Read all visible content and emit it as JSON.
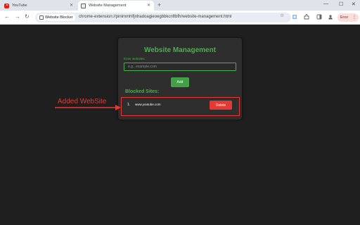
{
  "browser": {
    "tabs": [
      {
        "title": "YouTube",
        "icon": "youtube-icon",
        "active": false
      },
      {
        "title": "Website Management",
        "icon": "extension-page-icon",
        "active": true
      }
    ],
    "new_tab_symbol": "+",
    "window_controls": {
      "minimize": "—",
      "maximize": "☐",
      "close": "✕"
    },
    "nav": {
      "back": "←",
      "forward": "→",
      "reload": "↻"
    },
    "site_chip": "Website Blocker",
    "url": "chrome-extension://pinimmhlfjnhadoagieoegbbkcnftbfh/website-management.html",
    "bookmark_symbol": "☆",
    "error_button": "Error",
    "menu_symbol": "⋮"
  },
  "app": {
    "title": "Website Management",
    "input_label": "Enter websites:",
    "input_placeholder": "e.g., example.com",
    "input_value": "",
    "add_button": "Add",
    "blocked_heading": "Blocked Sites:",
    "blocked_sites": [
      {
        "number": "1.",
        "site": "www.youtube.com",
        "delete_label": "Delete"
      }
    ]
  },
  "annotation": {
    "label": "Added WebSite",
    "color": "#e53935"
  },
  "colors": {
    "accent_green": "#4caf50",
    "delete_red": "#e53935",
    "page_background": "#1f1f1f",
    "card_background": "#2e2e2e"
  }
}
